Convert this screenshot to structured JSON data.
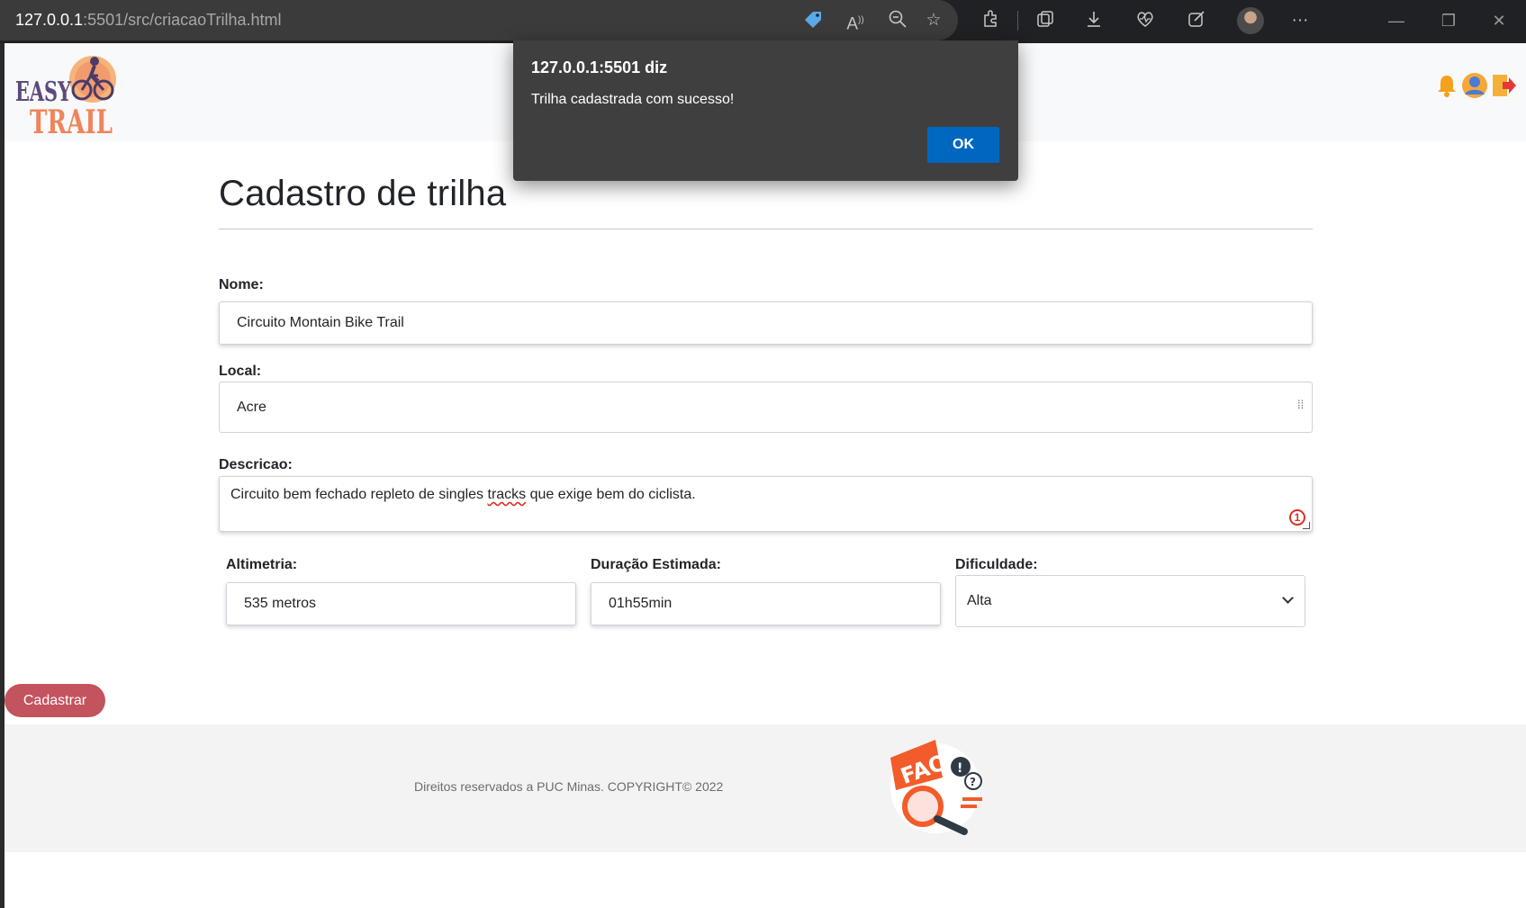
{
  "browser": {
    "url_host": "127.0.0.1",
    "url_rest": ":5501/src/criacaoTrilha.html",
    "icons": [
      "tag-icon",
      "read-aloud-icon",
      "zoom-out-icon",
      "add-favorite-icon",
      "extensions-icon",
      "collections-icon",
      "downloads-icon",
      "health-icon",
      "edit-icon",
      "profile-avatar",
      "more-icon",
      "minimize-icon",
      "restore-icon",
      "close-icon"
    ]
  },
  "header": {
    "logo_text_top": "EASY",
    "logo_text_bottom": "TRAIL"
  },
  "form": {
    "title": "Cadastro de trilha",
    "nome_label": "Nome:",
    "nome_value": "Circuito Montain Bike Trail",
    "local_label": "Local:",
    "local_value": "Acre",
    "descricao_label": "Descricao:",
    "descricao_pre": "Circuito bem fechado repleto de singles ",
    "descricao_misspelled": "tracks",
    "descricao_post": " que exige bem do ciclista.",
    "altimetria_label": "Altimetria:",
    "altimetria_value": "535 metros",
    "duracao_label": "Duração Estimada:",
    "duracao_value": "01h55min",
    "dificuldade_label": "Dificuldade:",
    "dificuldade_value": "Alta",
    "submit_label": "Cadastrar"
  },
  "footer": {
    "copyright": "Direitos reservados a PUC Minas. COPYRIGHT© 2022",
    "faq_text": "FAQ"
  },
  "dialog": {
    "title": "127.0.0.1:5501 diz",
    "message": "Trilha cadastrada com sucesso!",
    "ok_label": "OK"
  },
  "colors": {
    "button": "#c3535d",
    "dialog_bg": "#3f3f3f",
    "dialog_ok": "#0067c0",
    "logo_purple": "#5b4a7a",
    "logo_orange": "#f0845c"
  }
}
